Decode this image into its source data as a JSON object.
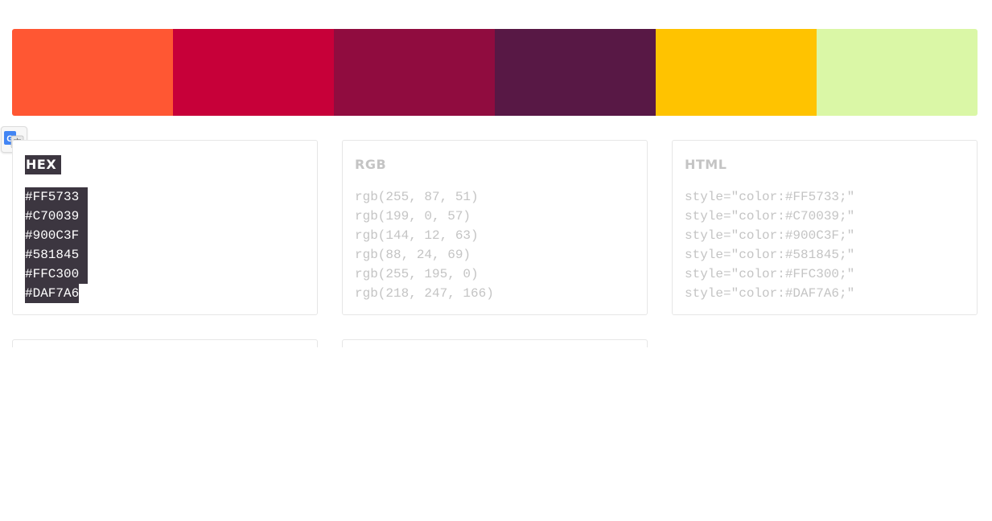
{
  "palette": {
    "colors": [
      "#FF5733",
      "#C70039",
      "#900C3F",
      "#581845",
      "#FFC300",
      "#DAF7A6"
    ]
  },
  "translate_button": {
    "icon": "google-translate-icon"
  },
  "cards": {
    "hex": {
      "title": "HEX",
      "items": [
        "#FF5733",
        "#C70039",
        "#900C3F",
        "#581845",
        "#FFC300",
        "#DAF7A6"
      ]
    },
    "rgb": {
      "title": "RGB",
      "items": [
        "rgb(255, 87, 51)",
        "rgb(199, 0, 57)",
        "rgb(144, 12, 63)",
        "rgb(88, 24, 69)",
        "rgb(255, 195, 0)",
        "rgb(218, 247, 166)"
      ]
    },
    "html": {
      "title": "HTML",
      "items": [
        "style=\"color:#FF5733;\"",
        "style=\"color:#C70039;\"",
        "style=\"color:#900C3F;\"",
        "style=\"color:#581845;\"",
        "style=\"color:#FFC300;\"",
        "style=\"color:#DAF7A6;\""
      ]
    }
  }
}
